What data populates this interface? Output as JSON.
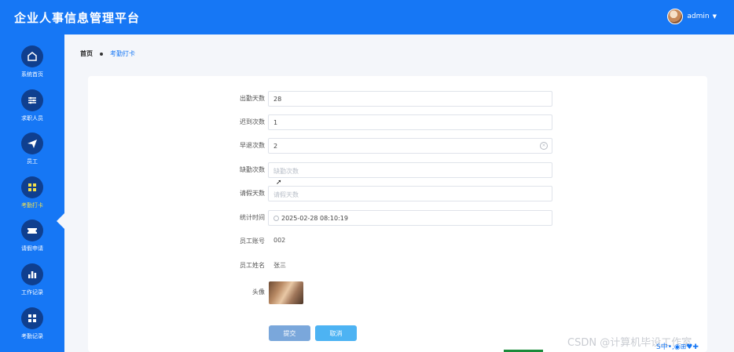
{
  "app": {
    "title": "企业人事信息管理平台",
    "user": "admin"
  },
  "sidebar": {
    "items": [
      {
        "label": "系统首页",
        "icon": "home-icon"
      },
      {
        "label": "求职人员",
        "icon": "sliders-icon"
      },
      {
        "label": "员工",
        "icon": "paper-plane-icon"
      },
      {
        "label": "考勤打卡",
        "icon": "grid-icon"
      },
      {
        "label": "请假申请",
        "icon": "ticket-icon"
      },
      {
        "label": "工作记录",
        "icon": "bar-chart-icon"
      },
      {
        "label": "考勤记录",
        "icon": "grid-icon"
      }
    ],
    "active_index": 3
  },
  "breadcrumb": {
    "home": "首页",
    "current": "考勤打卡"
  },
  "form": {
    "attendance_days": {
      "label": "出勤天数",
      "value": "28"
    },
    "late_count": {
      "label": "迟到次数",
      "value": "1"
    },
    "early_leave_count": {
      "label": "早退次数",
      "value": "2"
    },
    "absence_count": {
      "label": "缺勤次数",
      "placeholder": "缺勤次数"
    },
    "leave_days": {
      "label": "请假天数",
      "placeholder": "请假天数"
    },
    "stat_time": {
      "label": "统计时间",
      "value": "2025-02-28 08:10:19"
    },
    "employee_no": {
      "label": "员工账号",
      "value": "002"
    },
    "employee_name": {
      "label": "员工姓名",
      "value": "张三"
    },
    "avatar": {
      "label": "头像"
    },
    "submit_label": "提交",
    "cancel_label": "取消"
  },
  "watermark": "CSDN @计算机毕设工作室",
  "tray": "S中•,◉⊞♥✚",
  "colors": {
    "primary": "#1677f5",
    "nav_circle": "#0f3f8f",
    "active_label": "#f5e14a"
  }
}
